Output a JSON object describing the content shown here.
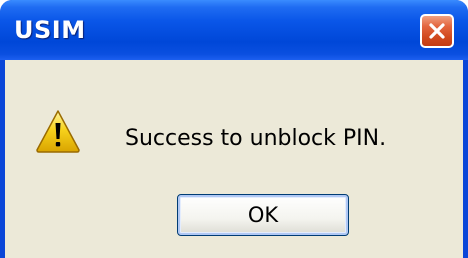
{
  "window": {
    "title": "USIM"
  },
  "dialog": {
    "icon": "warning-icon",
    "message": "Success to unblock PIN.",
    "ok_label": "OK"
  },
  "colors": {
    "titlebar": "#0a56e8",
    "client_bg": "#ece9d8",
    "close_button": "#d14a1e",
    "warning_yellow": "#f7d21c"
  }
}
